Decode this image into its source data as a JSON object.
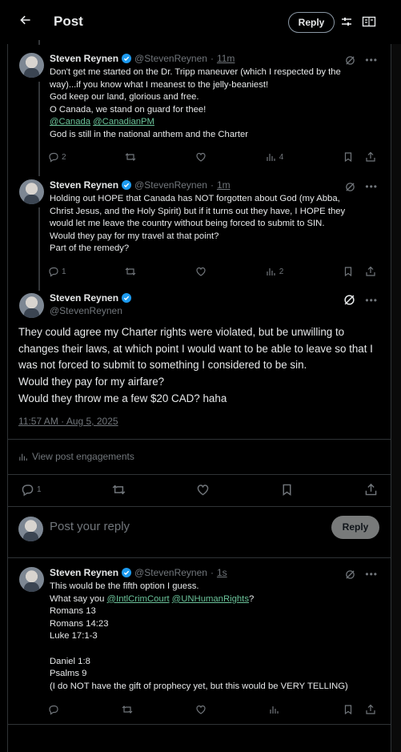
{
  "header": {
    "title": "Post",
    "reply_label": "Reply"
  },
  "posts": [
    {
      "name": "Steven Reynen",
      "handle": "@StevenReynen",
      "sep": "·",
      "time": "11m",
      "lines": [
        "Don't get me started on the Dr. Tripp maneuver (which I respected by the",
        "way)...if you know what I meanest to the jelly-beaniest!",
        "God keep our land, glorious and free.",
        "O Canada, we stand on guard for thee!"
      ],
      "mention1": "@Canada",
      "mention2": "@CanadianPM",
      "last_line": "God is still in the national anthem and the Charter",
      "replies": "2",
      "reposts": "",
      "likes": "",
      "views": "4"
    },
    {
      "name": "Steven Reynen",
      "handle": "@StevenReynen",
      "sep": "·",
      "time": "1m",
      "lines": [
        "Holding out HOPE that Canada has NOT forgotten about God (my Abba,",
        "Christ Jesus, and the Holy Spirit) but if it turns out they have, I HOPE they",
        "would let me leave the country without being forced to submit to SIN.",
        "Would they pay for my travel at that point?",
        "Part of the remedy?"
      ],
      "replies": "1",
      "reposts": "",
      "likes": "",
      "views": "2"
    }
  ],
  "main": {
    "name": "Steven Reynen",
    "handle": "@StevenReynen",
    "lines": [
      "They could agree my Charter rights were violated, but be unwilling to",
      "changes their laws, at which point I would want to be able to leave so that I",
      "was not forced to submit to something I considered to be sin.",
      "Would they pay for my airfare?",
      "Would they throw me a few $20 CAD? haha"
    ],
    "timestamp": "11:57 AM · Aug 5, 2025",
    "engagements": "View post engagements",
    "replies": "1"
  },
  "compose": {
    "placeholder": "Post your reply",
    "button": "Reply"
  },
  "reply_post": {
    "name": "Steven Reynen",
    "handle": "@StevenReynen",
    "sep": "·",
    "time": "1s",
    "line1": "This would be the fifth option I guess.",
    "what_say": "What say you",
    "mention1": "@IntlCrimCourt",
    "mention2": "@UNHumanRights",
    "q": "?",
    "lines": [
      "Romans 13",
      "Romans 14:23",
      "Luke 17:1-3",
      "",
      "Daniel 1:8",
      "Psalms 9",
      "(I do NOT have the gift of prophecy yet, but this would be VERY TELLING)"
    ]
  },
  "colors": {
    "accent_link": "#6bc39a",
    "verified": "#1d9bf0",
    "muted": "#71767b"
  }
}
